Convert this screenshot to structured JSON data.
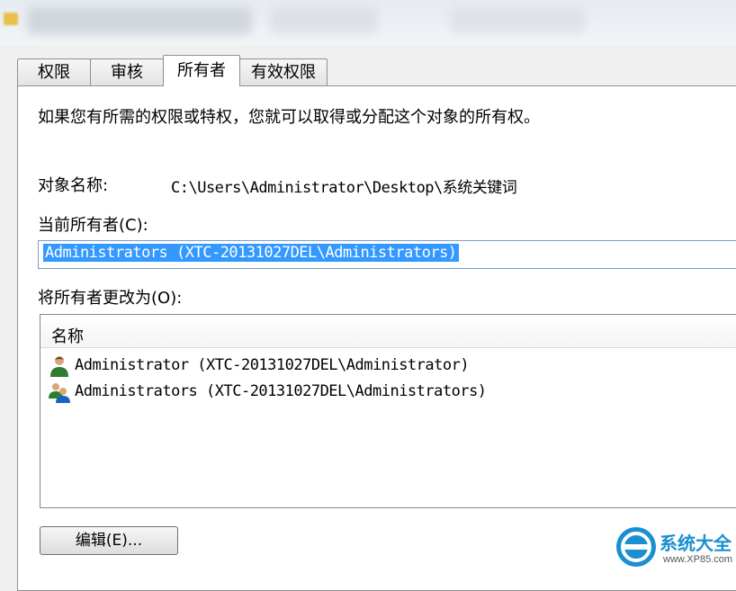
{
  "tabs": [
    {
      "label": "权限"
    },
    {
      "label": "审核"
    },
    {
      "label": "所有者"
    },
    {
      "label": "有效权限"
    }
  ],
  "active_tab": "所有者",
  "intro_text": "如果您有所需的权限或特权，您就可以取得或分配这个对象的所有权。",
  "object": {
    "label": "对象名称:",
    "path": "C:\\Users\\Administrator\\Desktop\\系统关键词"
  },
  "current_owner": {
    "label": "当前所有者(C):",
    "value": "Administrators (XTC-20131027DEL\\Administrators)"
  },
  "change_owner": {
    "label": "将所有者更改为(O):",
    "column_header": "名称",
    "rows": [
      {
        "name": "Administrator (XTC-20131027DEL\\Administrator)",
        "icon": "user-icon"
      },
      {
        "name": "Administrators (XTC-20131027DEL\\Administrators)",
        "icon": "group-icon"
      }
    ]
  },
  "edit_button": "编辑(E)...",
  "watermark": {
    "name": "系统大全",
    "url": "www.XP85.com"
  },
  "colors": {
    "selection": "#3399ff",
    "watermark": "#1a8fd1"
  }
}
